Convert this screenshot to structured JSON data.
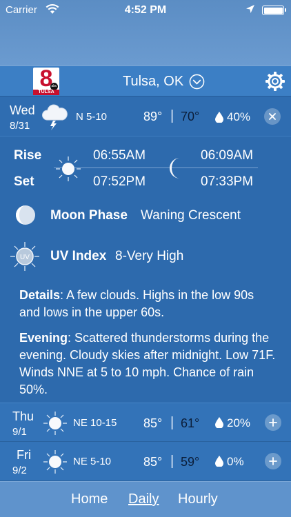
{
  "status_bar": {
    "carrier": "Carrier",
    "time": "4:52 PM"
  },
  "header": {
    "logo_text": "8",
    "logo_subtext": "TULSA",
    "logo_network": "abc",
    "city": "Tulsa, OK"
  },
  "today": {
    "day": "Wed",
    "date": "8/31",
    "wind": "N 5-10",
    "high": "89°",
    "separator": "|",
    "low": "70°",
    "precip": "40%",
    "icon": "thunderstorm-cloud-icon",
    "details": {
      "rise_label": "Rise",
      "set_label": "Set",
      "sunrise": "06:55AM",
      "sunset": "07:52PM",
      "moonrise": "06:09AM",
      "moonset": "07:33PM",
      "moon_phase_label": "Moon Phase",
      "moon_phase_value": "Waning Crescent",
      "uv_label": "UV Index",
      "uv_value": "8-Very High",
      "uv_icon_text": "UV",
      "details_label": "Details",
      "details_text": ": A few clouds. Highs in the low 90s and lows in the upper 60s.",
      "evening_label": "Evening",
      "evening_text": ": Scattered thunderstorms during the evening. Cloudy skies after midnight. Low 71F. Winds NNE at 5 to 10 mph. Chance of rain 50%."
    }
  },
  "forecast": [
    {
      "day": "Thu",
      "date": "9/1",
      "wind": "NE 10-15",
      "high": "85°",
      "separator": "|",
      "low": "61°",
      "precip": "20%",
      "icon": "sun-icon"
    },
    {
      "day": "Fri",
      "date": "9/2",
      "wind": "NE 5-10",
      "high": "85°",
      "separator": "|",
      "low": "59°",
      "precip": "0%",
      "icon": "sun-icon"
    }
  ],
  "bottom_nav": {
    "items": [
      "Home",
      "Daily",
      "Hourly"
    ],
    "active": "Daily"
  },
  "colors": {
    "background": "#2d6aad",
    "header": "#3c7fc5",
    "low_temp": "#0b1e3a",
    "logo_red": "#c8102e"
  }
}
